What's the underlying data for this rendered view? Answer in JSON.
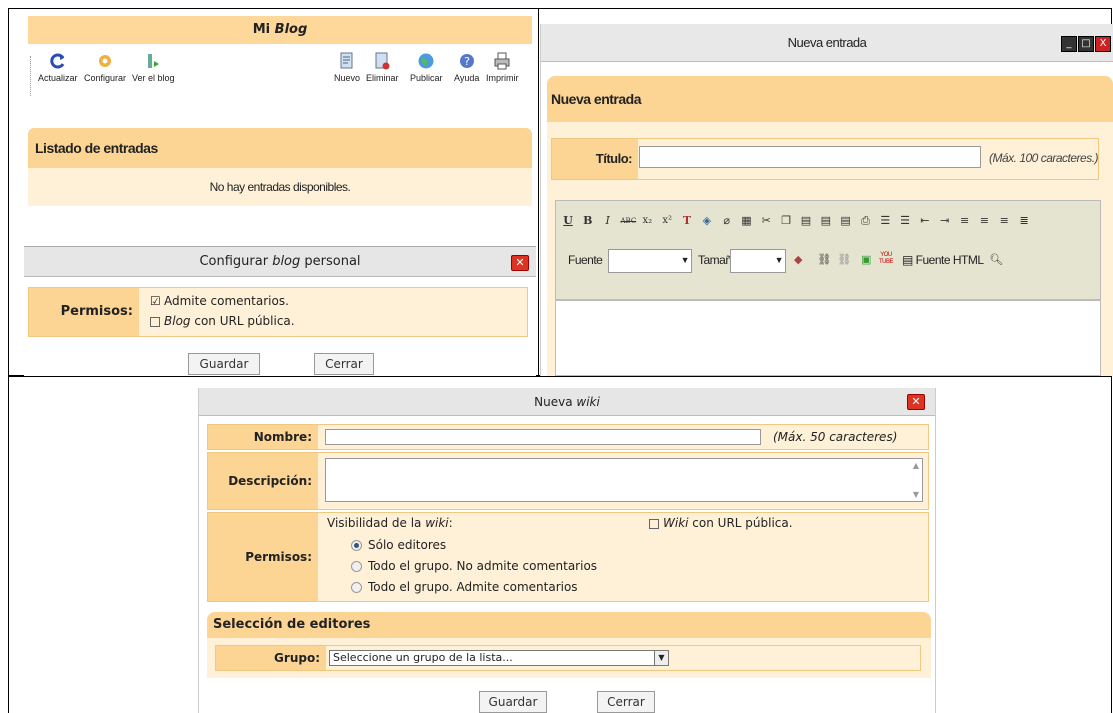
{
  "blog": {
    "title_prefix": "Mi ",
    "title_em": "Blog",
    "toolbar_left": [
      {
        "label": "Actualizar"
      },
      {
        "label": "Configurar"
      },
      {
        "label": "Ver el blog"
      }
    ],
    "toolbar_right": [
      {
        "label": "Nuevo"
      },
      {
        "label": "Eliminar"
      },
      {
        "label": "Publicar"
      },
      {
        "label": "Ayuda"
      },
      {
        "label": "Imprimir"
      }
    ],
    "list_heading": "Listado de entradas",
    "empty_text": "No hay entradas disponibles."
  },
  "config_dialog": {
    "title_a": "Configurar ",
    "title_em": "blog",
    "title_b": " personal",
    "permisos_label": "Permisos:",
    "opt1": "Admite comentarios.",
    "opt2_em": "Blog",
    "opt2": " con URL pública.",
    "save": "Guardar",
    "close": "Cerrar"
  },
  "entrada": {
    "window_title": "Nueva entrada",
    "heading": "Nueva entrada",
    "titulo_label": "Título:",
    "titulo_hint": "(Máx. 100 caracteres.)",
    "fuente_label": "Fuente",
    "tamano_label": "Tamaño",
    "fuente_html": "Fuente HTML"
  },
  "wiki": {
    "title_a": "Nueva ",
    "title_em": "wiki",
    "nombre_label": "Nombre:",
    "nombre_hint": "(Máx. 50 caracteres)",
    "descripcion_label": "Descripción:",
    "permisos_label": "Permisos:",
    "visibilidad_a": "Visibilidad de la ",
    "visibilidad_em": "wiki",
    "visibilidad_b": ":",
    "wiki_url_em": "Wiki",
    "wiki_url": " con URL pública.",
    "radio1": "Sólo editores",
    "radio2": "Todo el grupo. No admite comentarios",
    "radio3": "Todo el grupo. Admite comentarios",
    "editors_heading": "Selección de editores",
    "grupo_label": "Grupo:",
    "grupo_select": "Seleccione un grupo de la lista...",
    "save": "Guardar",
    "close": "Cerrar"
  }
}
